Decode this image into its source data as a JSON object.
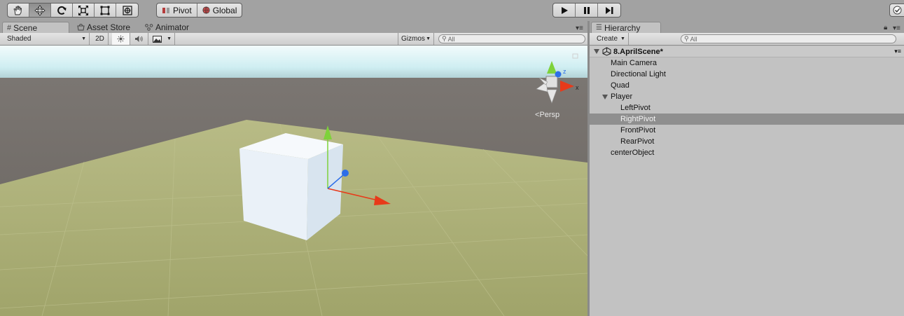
{
  "toolbar": {
    "tools": [
      {
        "name": "hand-tool",
        "icon": "hand-icon",
        "active": false
      },
      {
        "name": "move-tool",
        "icon": "move-arrows-icon",
        "active": true
      },
      {
        "name": "rotate-tool",
        "icon": "rotate-icon",
        "active": false
      },
      {
        "name": "scale-tool",
        "icon": "scale-icon",
        "active": false
      },
      {
        "name": "rect-tool",
        "icon": "rect-icon",
        "active": false
      },
      {
        "name": "transform-tool",
        "icon": "transform-icon",
        "active": false
      }
    ],
    "pivot_label": "Pivot",
    "global_label": "Global",
    "play_icon": "play-icon",
    "pause_icon": "pause-icon",
    "step_icon": "step-icon"
  },
  "scene_panel": {
    "tabs": [
      {
        "label": "Scene",
        "icon": "grid-icon",
        "active": true
      },
      {
        "label": "Asset Store",
        "icon": "store-icon",
        "active": false
      },
      {
        "label": "Animator",
        "icon": "animator-icon",
        "active": false
      }
    ],
    "shading_mode": "Shaded",
    "mode_2d": "2D",
    "gizmos_label": "Gizmos",
    "search_placeholder": "All",
    "projection_label": "Persp",
    "colors": {
      "sky": "#dff4f6",
      "horizon": "#6a6560",
      "ground": "#a6a970",
      "cube": "#f4f8fc",
      "x_axis": "#e83a1a",
      "y_axis": "#7ed23a",
      "z_axis": "#2d6ee8"
    }
  },
  "hierarchy": {
    "tab_label": "Hierarchy",
    "create_label": "Create",
    "search_placeholder": "All",
    "scene_name": "8.AprilScene*",
    "items": [
      {
        "label": "Main Camera",
        "depth": 1,
        "expandable": false,
        "selected": false
      },
      {
        "label": "Directional Light",
        "depth": 1,
        "expandable": false,
        "selected": false
      },
      {
        "label": "Quad",
        "depth": 1,
        "expandable": false,
        "selected": false
      },
      {
        "label": "Player",
        "depth": 1,
        "expandable": true,
        "selected": false
      },
      {
        "label": "LeftPivot",
        "depth": 2,
        "expandable": false,
        "selected": false
      },
      {
        "label": "RightPivot",
        "depth": 2,
        "expandable": false,
        "selected": true
      },
      {
        "label": "FrontPivot",
        "depth": 2,
        "expandable": false,
        "selected": false
      },
      {
        "label": "RearPivot",
        "depth": 2,
        "expandable": false,
        "selected": false
      },
      {
        "label": "centerObject",
        "depth": 1,
        "expandable": false,
        "selected": false
      }
    ]
  }
}
